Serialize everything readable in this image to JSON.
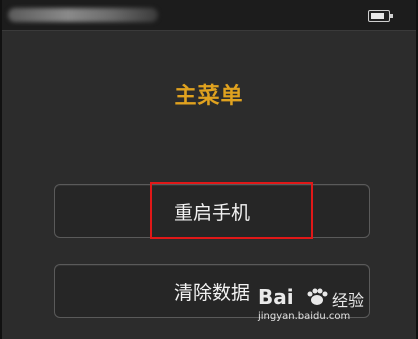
{
  "status_bar": {
    "battery_level": 0.8
  },
  "menu": {
    "title": "主菜单",
    "items": [
      {
        "label": "重启手机",
        "highlighted": true
      },
      {
        "label": "清除数据",
        "highlighted": false
      }
    ]
  },
  "watermark": {
    "brand": "Bai",
    "brand_suffix": "经验",
    "url": "jingyan.baidu.com"
  },
  "colors": {
    "title": "#e0a21f",
    "highlight": "#e01818",
    "background": "#2c2c2c"
  }
}
